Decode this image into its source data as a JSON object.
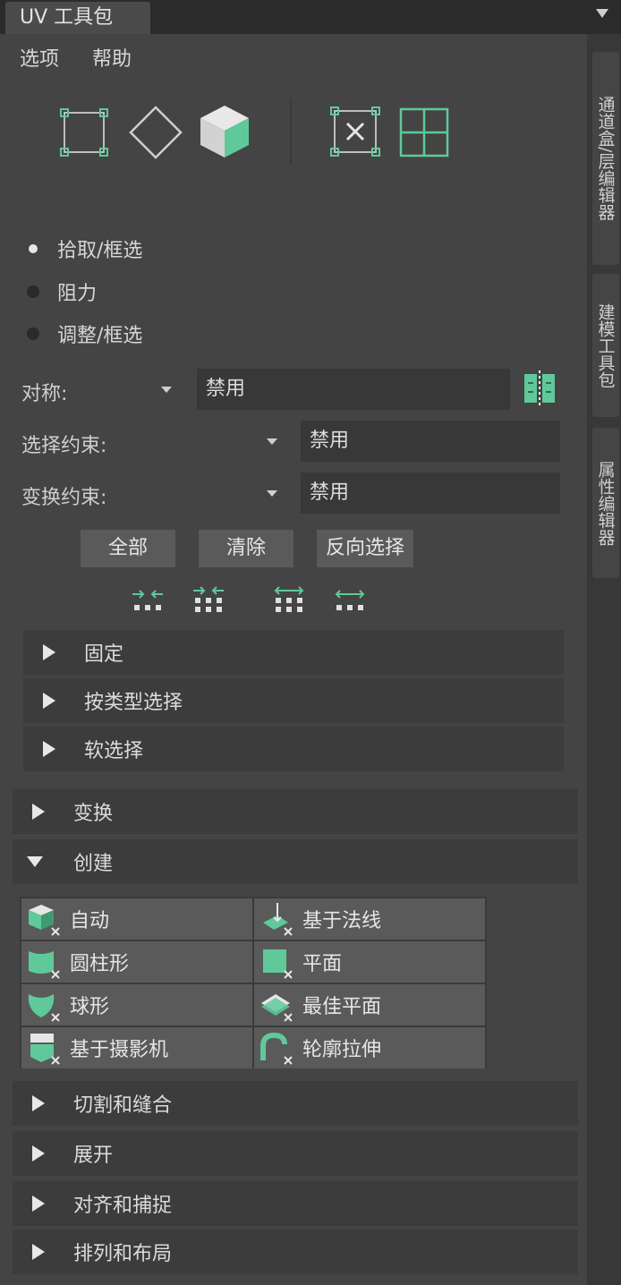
{
  "window": {
    "title": "UV 工具包"
  },
  "menu": {
    "options": "选项",
    "help": "帮助"
  },
  "side_tabs": [
    "通道盒/层编辑器",
    "建模工具包",
    "属性编辑器"
  ],
  "tool_icons": [
    "uv-shell-select-icon",
    "uv-edge-select-icon",
    "uv-face-select-icon",
    "uv-select-contained-icon",
    "uv-grid-view-icon"
  ],
  "select_mode": {
    "options": [
      "拾取/框选",
      "阻力",
      "调整/框选"
    ],
    "selected": "拾取/框选"
  },
  "symmetry": {
    "label": "对称:",
    "value": "禁用"
  },
  "select_constraint": {
    "label": "选择约束:",
    "value": "禁用"
  },
  "transform_constraint": {
    "label": "变换约束:",
    "value": "禁用"
  },
  "buttons": {
    "all": "全部",
    "clear": "清除",
    "invert": "反向选择"
  },
  "sub_sections": [
    "固定",
    "按类型选择",
    "软选择"
  ],
  "sections_top": [
    {
      "label": "变换",
      "expanded": false
    },
    {
      "label": "创建",
      "expanded": true
    }
  ],
  "create_tools": [
    {
      "label": "自动",
      "icon": "auto-map-icon"
    },
    {
      "label": "基于法线",
      "icon": "normal-based-map-icon"
    },
    {
      "label": "圆柱形",
      "icon": "cylindrical-map-icon"
    },
    {
      "label": "平面",
      "icon": "planar-map-icon"
    },
    {
      "label": "球形",
      "icon": "spherical-map-icon"
    },
    {
      "label": "最佳平面",
      "icon": "best-plane-map-icon"
    },
    {
      "label": "基于摄影机",
      "icon": "camera-based-map-icon"
    },
    {
      "label": "轮廓拉伸",
      "icon": "contour-stretch-icon"
    }
  ],
  "sections_bottom": [
    "切割和缝合",
    "展开",
    "对齐和捕捉",
    "排列和布局"
  ],
  "colors": {
    "accent": "#5fc99a",
    "panel": "#444444",
    "bar": "#3c3c3c",
    "button": "#5a5a5a"
  }
}
